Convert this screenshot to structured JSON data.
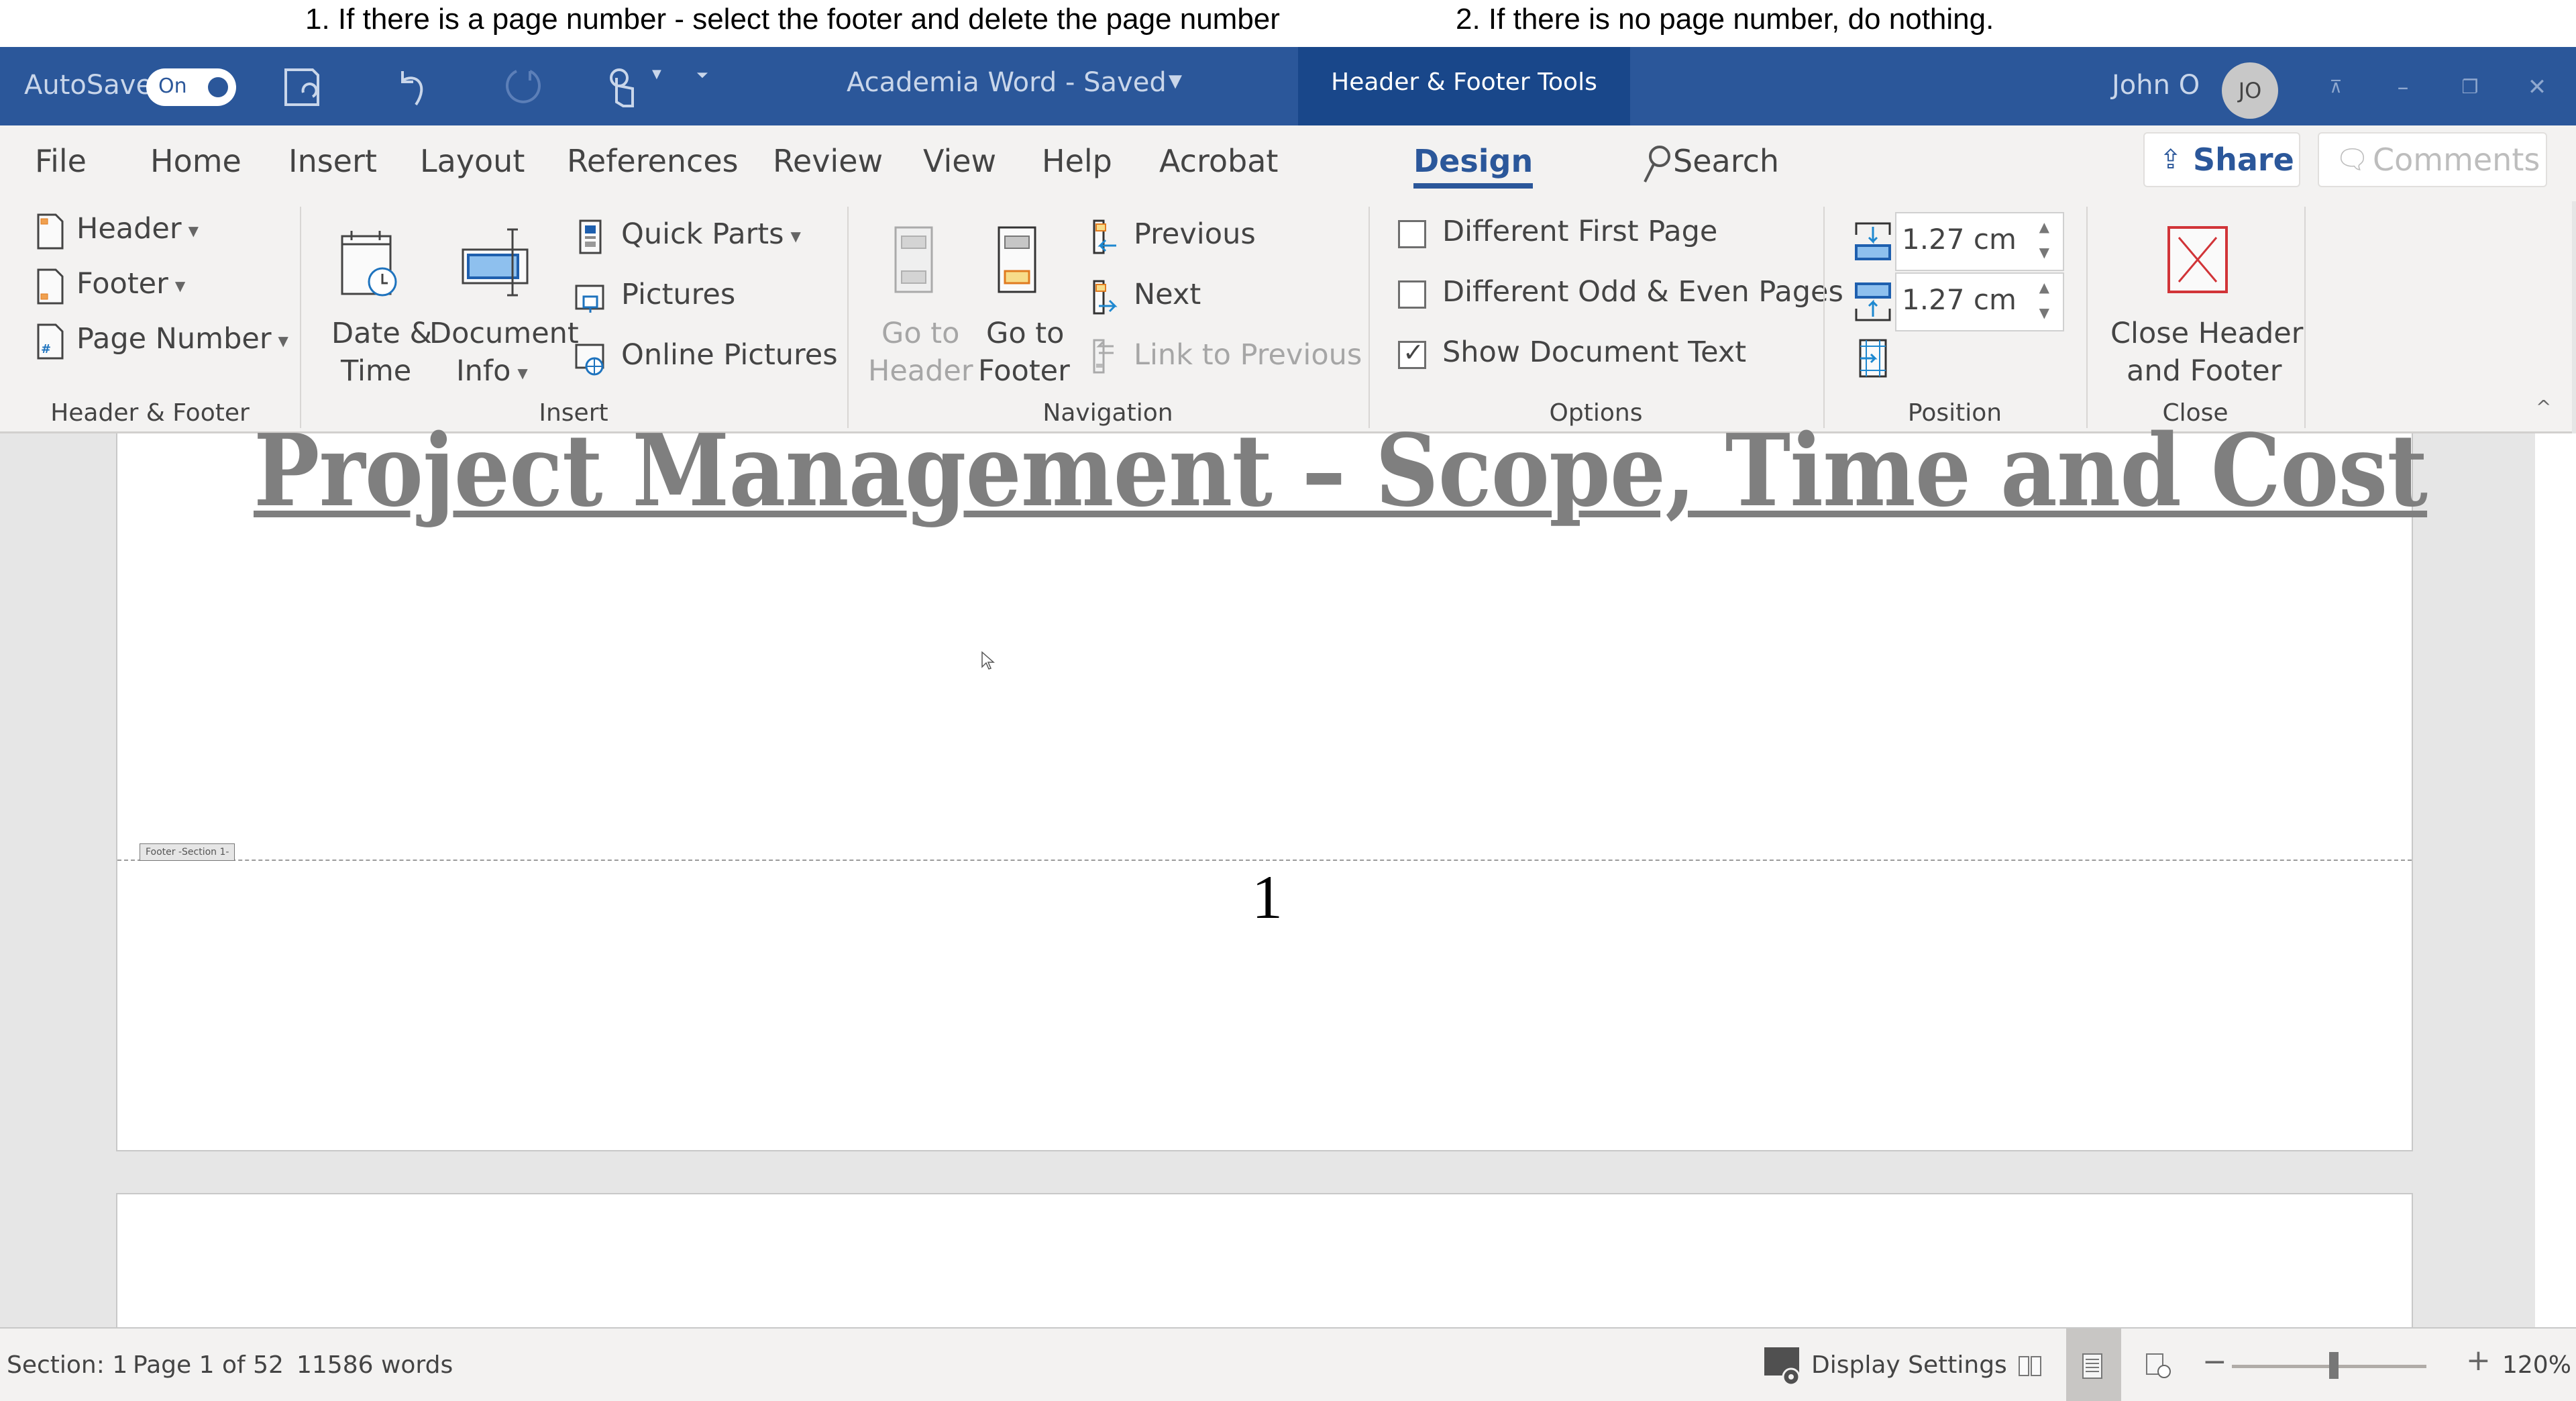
{
  "instructions": {
    "step1": "1. If there is a page number - select the footer and delete the page number",
    "step2": "2. If there is no page number, do nothing."
  },
  "titlebar": {
    "autosave_label": "AutoSave",
    "autosave_state": "On",
    "quick_access": [
      "save-icon",
      "undo-icon",
      "redo-icon",
      "touch-mode-icon",
      "customize-qat-icon"
    ],
    "doc_title": "Academia Word  -  Saved",
    "context_tab": "Header & Footer Tools",
    "user_name": "John O",
    "user_initials": "JO",
    "window_buttons": [
      "ribbon-display-options",
      "minimize",
      "restore",
      "close"
    ]
  },
  "tabs": {
    "items": [
      "File",
      "Home",
      "Insert",
      "Layout",
      "References",
      "Review",
      "View",
      "Help",
      "Acrobat",
      "Design"
    ],
    "active": "Design",
    "search_label": "Search",
    "share_label": "Share",
    "comments_label": "Comments"
  },
  "ribbon": {
    "groups": {
      "header_footer": {
        "label": "Header & Footer",
        "header": "Header",
        "footer": "Footer",
        "page_number": "Page Number"
      },
      "insert": {
        "label": "Insert",
        "date_time_1": "Date &",
        "date_time_2": "Time",
        "doc_info_1": "Document",
        "doc_info_2": "Info",
        "quick_parts": "Quick Parts",
        "pictures": "Pictures",
        "online_pictures": "Online Pictures"
      },
      "navigation": {
        "label": "Navigation",
        "goto_header_1": "Go to",
        "goto_header_2": "Header",
        "goto_footer_1": "Go to",
        "goto_footer_2": "Footer",
        "previous": "Previous",
        "next": "Next",
        "link_to_previous": "Link to Previous"
      },
      "options": {
        "label": "Options",
        "different_first_page": {
          "label": "Different First Page",
          "checked": false
        },
        "different_odd_even": {
          "label": "Different Odd & Even Pages",
          "checked": false
        },
        "show_document_text": {
          "label": "Show Document Text",
          "checked": true
        }
      },
      "position": {
        "label": "Position",
        "header_from_top": "1.27 cm",
        "footer_from_bottom": "1.27 cm"
      },
      "close": {
        "label": "Close",
        "close_1": "Close Header",
        "close_2": "and Footer"
      }
    }
  },
  "document": {
    "title": "Project Management – Scope, Time and Cost",
    "footer_tag": "Footer -Section 1-",
    "page_number": "1"
  },
  "status": {
    "section": "Section: 1",
    "page": "Page 1 of 52",
    "words": "11586 words",
    "display_settings": "Display Settings",
    "zoom": "120%",
    "zoom_slider_percent": 120
  },
  "colors": {
    "brand": "#2b579a",
    "context_tab": "#19478a",
    "close_red": "#d13438"
  }
}
